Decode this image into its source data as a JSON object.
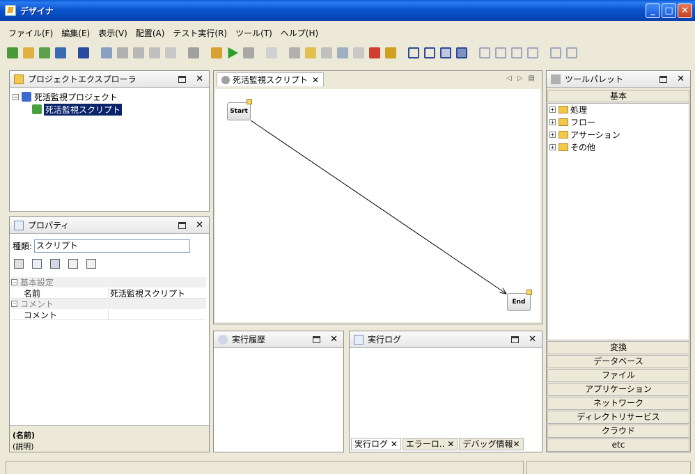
{
  "window": {
    "title": "デザイナ"
  },
  "menu": [
    "ファイル(F)",
    "編集(E)",
    "表示(V)",
    "配置(A)",
    "テスト実行(R)",
    "ツール(T)",
    "ヘルプ(H)"
  ],
  "project_explorer": {
    "title": "プロジェクトエクスプローラ",
    "project": "死活監視プロジェクト",
    "script": "死活監視スクリプト"
  },
  "properties": {
    "title": "プロパティ",
    "type_label": "種類:",
    "type_value": "スクリプト",
    "cat_basic": "基本設定",
    "name_key": "名前",
    "name_value": "死活監視スクリプト",
    "cat_comment": "コメント",
    "comment_key": "コメント",
    "comment_value": "",
    "desc_name": "(名前)",
    "desc_text": "(説明)"
  },
  "editor": {
    "tab": "死活監視スクリプト",
    "start_node": "Start",
    "end_node": "End"
  },
  "exec_history": {
    "title": "実行履歴"
  },
  "exec_log": {
    "title": "実行ログ",
    "tabs": [
      "実行ログ",
      "エラーロ..",
      "デバッグ情報"
    ]
  },
  "palette": {
    "title": "ツールパレット",
    "basic": "基本",
    "folders": [
      "処理",
      "フロー",
      "アサーション",
      "その他"
    ],
    "categories": [
      "変換",
      "データベース",
      "ファイル",
      "アプリケーション",
      "ネットワーク",
      "ディレクトリサービス",
      "クラウド",
      "etc"
    ]
  },
  "close_symbol": "✕"
}
